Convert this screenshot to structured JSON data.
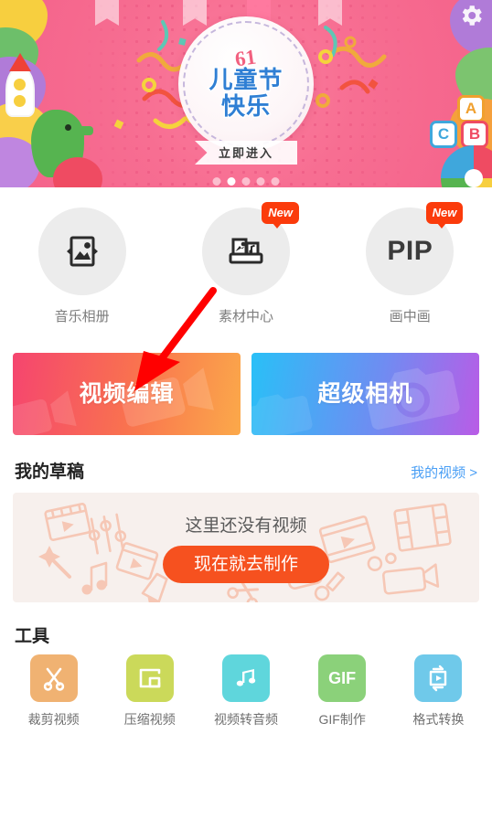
{
  "banner": {
    "badge_number": "61",
    "badge_line1": "儿童节",
    "badge_line2": "快乐",
    "cta_label": "立即进入",
    "gear_icon": "gear-icon",
    "bg_color": "#f4628a"
  },
  "quick_actions": [
    {
      "label": "音乐相册",
      "icon": "photo-frame-icon",
      "badge": ""
    },
    {
      "label": "素材中心",
      "icon": "material-tray-icon",
      "badge": "New"
    },
    {
      "label": "画中画",
      "icon": "PIP",
      "badge": "New"
    }
  ],
  "action_cards": [
    {
      "label": "视频编辑",
      "gradient_from": "#F5456F",
      "gradient_to": "#FBA94A",
      "watermark": "video-camera-watermark"
    },
    {
      "label": "超级相机",
      "gradient_from": "#29C0F7",
      "gradient_to": "#B95CE6",
      "watermark": "camera-watermark"
    }
  ],
  "drafts": {
    "title": "我的草稿",
    "link": "我的视频 >",
    "empty_text": "这里还没有视频",
    "cta_label": "现在就去制作",
    "cta_color": "#F6511F",
    "card_bg": "#F7F0ED"
  },
  "tools": {
    "title": "工具",
    "items": [
      {
        "label": "裁剪视频",
        "icon": "scissors-icon",
        "color": "#F0B272"
      },
      {
        "label": "压缩视频",
        "icon": "compress-icon",
        "color": "#CBD95A"
      },
      {
        "label": "视频转音频",
        "icon": "music-note-icon",
        "color": "#5FD6DC"
      },
      {
        "label": "GIF制作",
        "icon": "GIF",
        "color": "#8BD17A"
      },
      {
        "label": "格式转换",
        "icon": "format-convert-icon",
        "color": "#6FC9EA"
      }
    ]
  },
  "annotation": {
    "arrow": "red-arrow-pointer",
    "color": "#FF0000"
  }
}
